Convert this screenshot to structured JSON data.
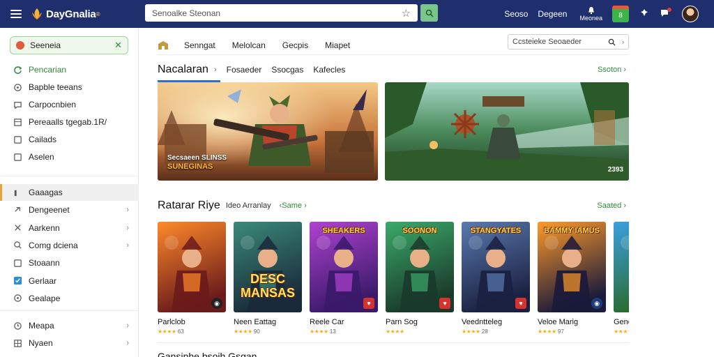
{
  "app": {
    "name": "DayGnalia",
    "search_placeholder": "Senoalke Steonan",
    "top_links": [
      "Seoso",
      "Degeen"
    ],
    "notifications_label": "Meonea",
    "calendar_label": "8"
  },
  "sidebar": {
    "top_chip": "Seeneia",
    "group1": [
      {
        "label": "Pencarian",
        "icon": "refresh-icon"
      },
      {
        "label": "Bapble teeans",
        "icon": "circle-icon"
      },
      {
        "label": "Carpocnbien",
        "icon": "chat-icon"
      },
      {
        "label": "Pereaalls tgegab.1R/",
        "icon": "document-icon"
      },
      {
        "label": "Cailads",
        "icon": "square-icon"
      },
      {
        "label": "Aselen",
        "icon": "square-icon"
      }
    ],
    "group2": [
      {
        "label": "Gaaagas",
        "icon": "bar-icon"
      },
      {
        "label": "Dengeenet",
        "icon": "link-icon"
      },
      {
        "label": "Aarkenn",
        "icon": "tools-icon"
      },
      {
        "label": "Comg dciena",
        "icon": "search-icon"
      },
      {
        "label": "Stoaann",
        "icon": "square-icon"
      },
      {
        "label": "Gerlaar",
        "icon": "check-icon"
      },
      {
        "label": "Gealape",
        "icon": "circle-icon"
      }
    ],
    "group3": [
      {
        "label": "Meapa",
        "icon": "clock-icon"
      },
      {
        "label": "Nyaen",
        "icon": "grid-icon"
      }
    ]
  },
  "subnav": {
    "tabs": [
      "Senngat",
      "Melolcan",
      "Gecpis",
      "Miapet"
    ],
    "search_placeholder": "Ccsteieke Seoaeder"
  },
  "section1": {
    "title": "Nacalaran",
    "links": [
      "Fosaeder",
      "Ssocgas",
      "Kafecles"
    ],
    "more": "Ssoton"
  },
  "banners": [
    {
      "caption_line1": "Secsaeen SLINSS",
      "caption_line2": "SUNEGINAS",
      "colors": [
        "#d98a3e",
        "#7b4a2a"
      ]
    },
    {
      "badge": "2393",
      "colors": [
        "#3a7a3a",
        "#1f4a2a"
      ]
    }
  ],
  "section2": {
    "title": "Ratarar Riye",
    "subtitle": "Ideo Arranlay",
    "green": "‹Same",
    "more": "Saated"
  },
  "tiles": [
    {
      "name": "Parlclob",
      "rating": "63",
      "logo": "",
      "badge": "dark",
      "bg": [
        "#ff8a2a",
        "#6b1b1b"
      ]
    },
    {
      "name": "Neen Eattag",
      "rating": "90",
      "logo": "DESC MANSAS",
      "badge": "none",
      "bg": [
        "#3a8a7a",
        "#1a2a3a"
      ]
    },
    {
      "name": "Reele Car",
      "rating": "13",
      "logo": "SHEAKERS",
      "badge": "red",
      "bg": [
        "#b042d0",
        "#3a1a6a"
      ]
    },
    {
      "name": "Parn Sog",
      "rating": "",
      "logo": "SOONON",
      "badge": "red",
      "bg": [
        "#3aaa6a",
        "#1a3a2a"
      ]
    },
    {
      "name": "Veedntteleg",
      "rating": "28",
      "logo": "STANGYATES",
      "badge": "red",
      "bg": [
        "#5a7ab0",
        "#1a2040"
      ]
    },
    {
      "name": "Veloe Marig",
      "rating": "97",
      "logo": "BAMMY IAMUS",
      "badge": "blue",
      "bg": [
        "#ff9a2a",
        "#1a1a3a"
      ]
    },
    {
      "name": "Gene",
      "rating": "",
      "logo": "",
      "badge": "none",
      "bg": [
        "#3aa0e0",
        "#2a6a2a"
      ]
    }
  ],
  "section3": {
    "title": "Gansinhe bsoih Gsgan"
  }
}
